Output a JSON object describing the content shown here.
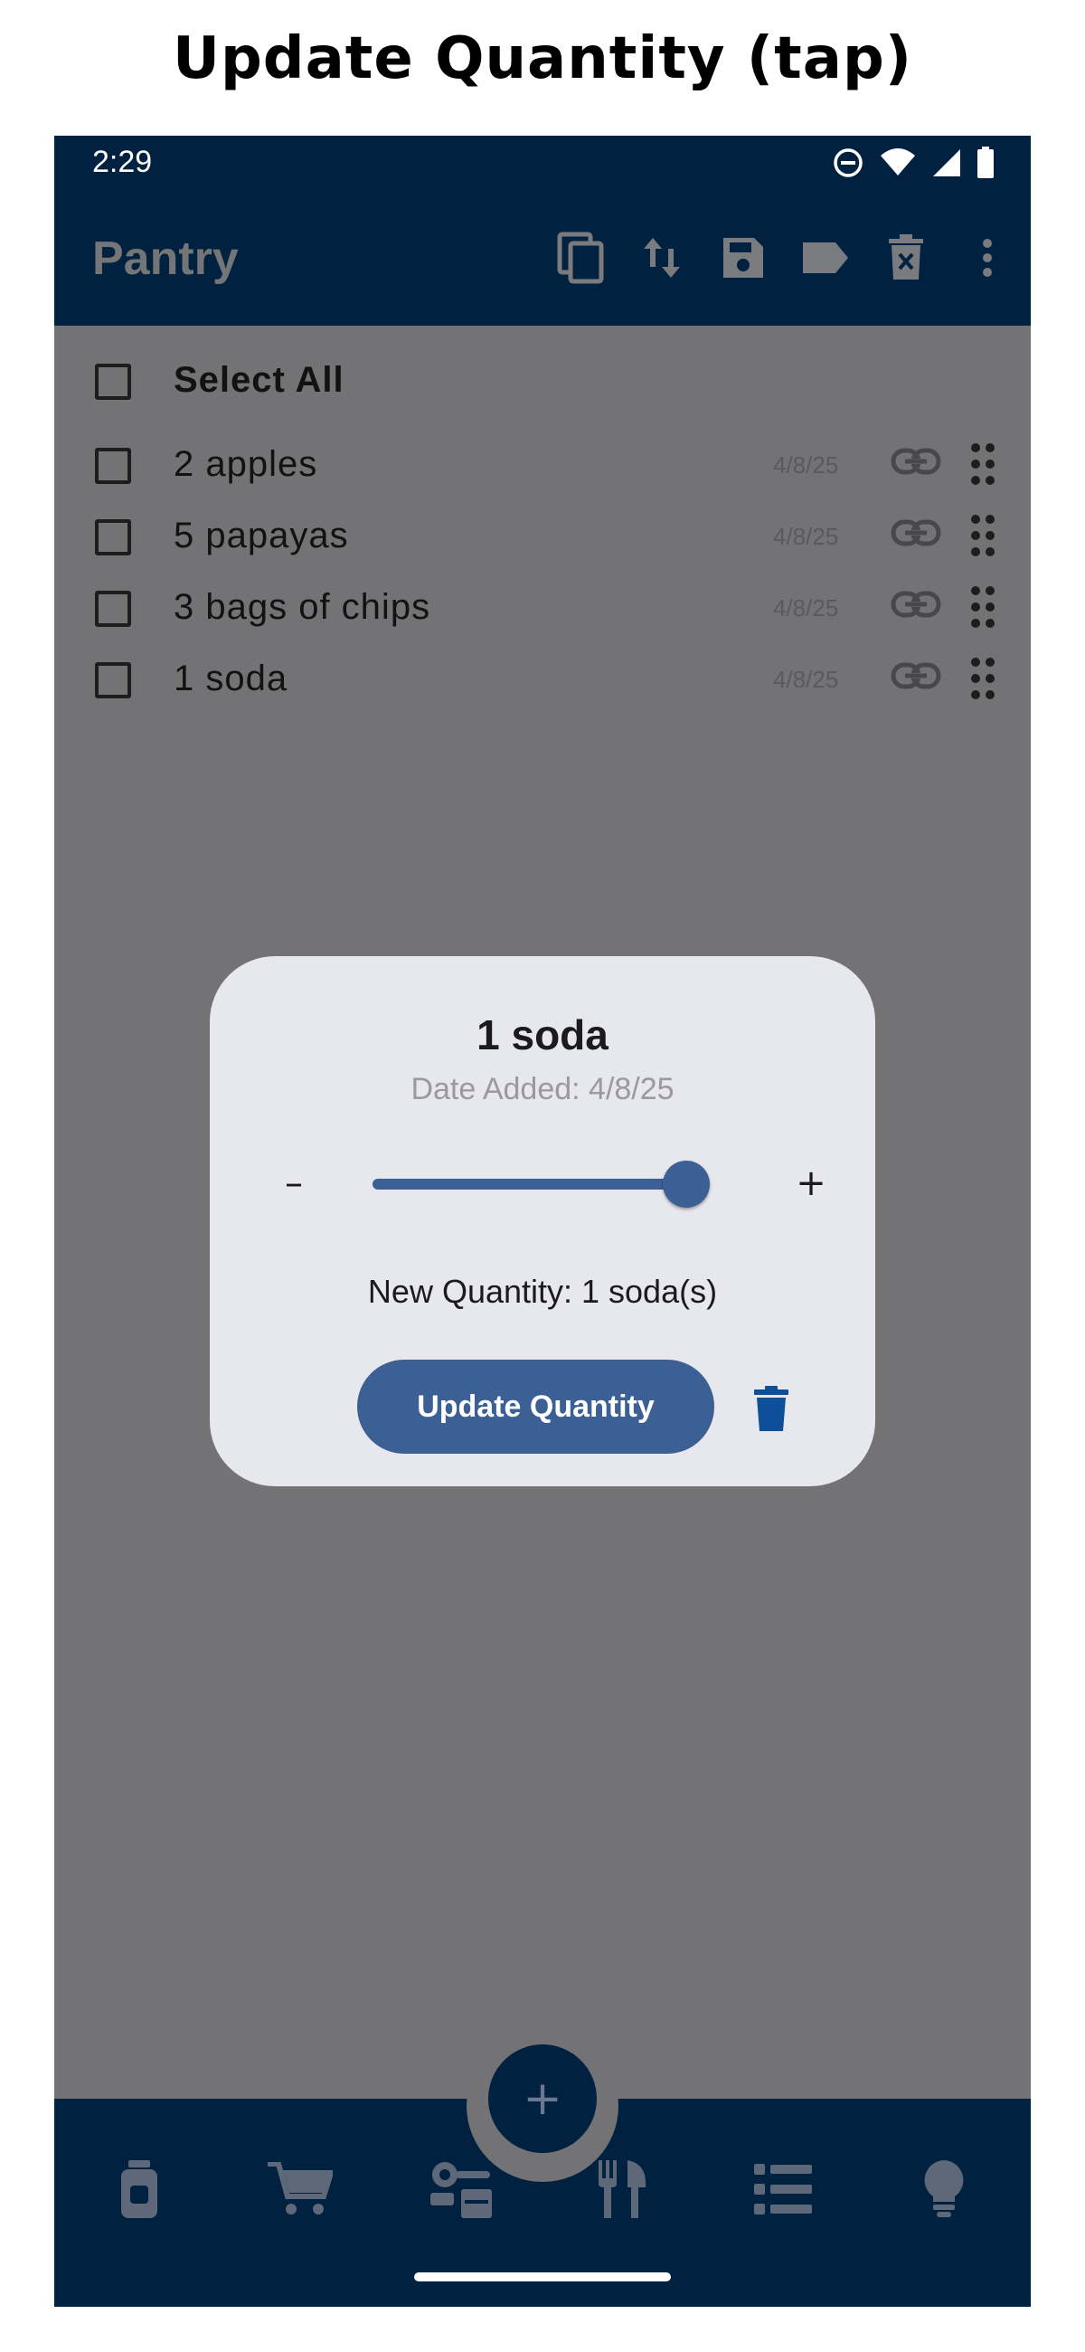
{
  "caption": "Update Quantity (tap)",
  "status": {
    "time": "2:29"
  },
  "appbar": {
    "title": "Pantry",
    "actions": [
      "copy-icon",
      "sort-icon",
      "save-icon",
      "label-icon",
      "delete-checked-icon",
      "more-vert-icon"
    ]
  },
  "list": {
    "select_all": "Select All",
    "items": [
      {
        "label": "2 apples",
        "date": "4/8/25"
      },
      {
        "label": "5 papayas",
        "date": "4/8/25"
      },
      {
        "label": "3 bags of chips",
        "date": "4/8/25"
      },
      {
        "label": "1 soda",
        "date": "4/8/25"
      }
    ]
  },
  "dialog": {
    "title": "1 soda",
    "date_added": "Date Added: 4/8/25",
    "decrement": "–",
    "increment": "+",
    "slider_value": 1.0,
    "new_quantity": "New Quantity: 1 soda(s)",
    "update_button": "Update Quantity"
  },
  "fab": {
    "label": "+"
  },
  "bottom_nav": [
    "pantry-jar-icon",
    "cart-icon",
    "kitchen-tools-icon",
    "meal-icon",
    "list-icon",
    "lightbulb-icon"
  ],
  "colors": {
    "primary": "#012140",
    "accent": "#3c5f94",
    "dialog_bg": "#e7e7ee",
    "scrim": "#737274"
  }
}
